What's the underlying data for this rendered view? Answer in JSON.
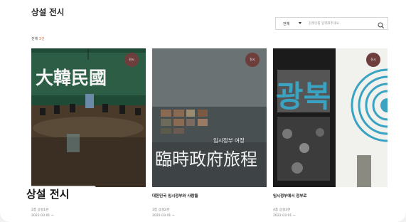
{
  "header": {
    "title": "상설 전시"
  },
  "summary": {
    "label": "전체",
    "count": "3건"
  },
  "search": {
    "category": "전체",
    "placeholder": "검색어를 입력해주세요."
  },
  "cards": [
    {
      "badge": "전시",
      "title": "",
      "meta1": "2층 상설1관",
      "meta2": "2022.03.01 ~",
      "image_text": "大韓民國"
    },
    {
      "badge": "전시",
      "title": "대한민국 임시정부와 사람들",
      "meta1": "3층 상설2관",
      "meta2": "2022.03.01 ~",
      "image_text": "臨時政府旅程",
      "image_subtext": "임시정부 여정"
    },
    {
      "badge": "전시",
      "title": "임시정부에서 정부로",
      "meta1": "4층 상설3관",
      "meta2": "2022.03.01 ~",
      "image_text": "광복"
    }
  ],
  "overlay": {
    "text": "상설 전시"
  },
  "colors": {
    "accent": "#e06b1f",
    "badge": "#6d3e3c",
    "poster_blue": "#3aa3c2"
  }
}
